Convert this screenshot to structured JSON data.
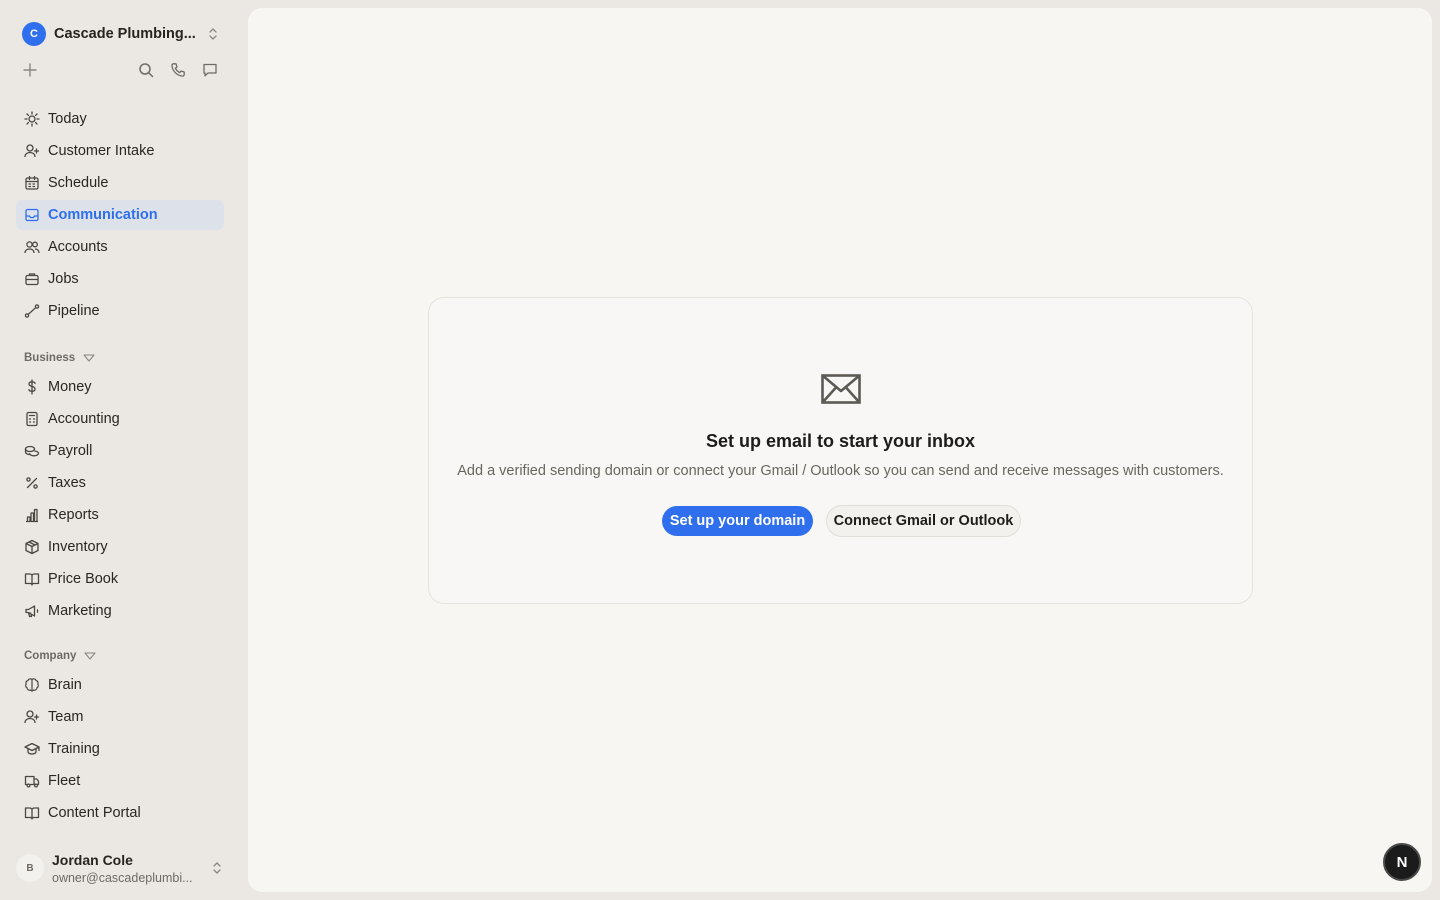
{
  "workspace": {
    "initial": "C",
    "name": "Cascade Plumbing..."
  },
  "toolbar": {
    "icons": [
      "plus-icon",
      "search-icon",
      "phone-icon",
      "message-icon"
    ]
  },
  "nav": {
    "items": [
      {
        "label": "Today",
        "icon": "sun-icon"
      },
      {
        "label": "Customer Intake",
        "icon": "user-plus-icon"
      },
      {
        "label": "Schedule",
        "icon": "calendar-icon"
      },
      {
        "label": "Communication",
        "icon": "inbox-icon",
        "active": true
      },
      {
        "label": "Accounts",
        "icon": "users-icon"
      },
      {
        "label": "Jobs",
        "icon": "briefcase-icon"
      },
      {
        "label": "Pipeline",
        "icon": "pipeline-icon"
      }
    ]
  },
  "business": {
    "header": "Business",
    "items": [
      {
        "label": "Money",
        "icon": "dollar-icon"
      },
      {
        "label": "Accounting",
        "icon": "calculator-icon"
      },
      {
        "label": "Payroll",
        "icon": "coins-icon"
      },
      {
        "label": "Taxes",
        "icon": "percent-icon"
      },
      {
        "label": "Reports",
        "icon": "bar-chart-icon"
      },
      {
        "label": "Inventory",
        "icon": "package-icon"
      },
      {
        "label": "Price Book",
        "icon": "book-icon"
      },
      {
        "label": "Marketing",
        "icon": "megaphone-icon"
      }
    ]
  },
  "company": {
    "header": "Company",
    "items": [
      {
        "label": "Brain",
        "icon": "brain-icon"
      },
      {
        "label": "Team",
        "icon": "team-icon"
      },
      {
        "label": "Training",
        "icon": "graduation-cap-icon"
      },
      {
        "label": "Fleet",
        "icon": "truck-icon"
      },
      {
        "label": "Content Portal",
        "icon": "book-open-icon"
      }
    ]
  },
  "user": {
    "initial": "B",
    "name": "Jordan Cole",
    "email": "owner@cascadeplumbi..."
  },
  "main": {
    "empty_state": {
      "icon": "mail-icon",
      "title": "Set up email to start your inbox",
      "subtitle": "Add a verified sending domain or connect your Gmail / Outlook so you can send and receive messages with customers.",
      "primary_label": "Set up your domain",
      "secondary_label": "Connect Gmail or Outlook"
    }
  },
  "fab": {
    "label": "N"
  },
  "colors": {
    "accent": "#2f6fed",
    "sidebar_bg": "#ebe8e3",
    "main_bg": "#f7f6f3",
    "active_bg": "#dde1ea"
  }
}
